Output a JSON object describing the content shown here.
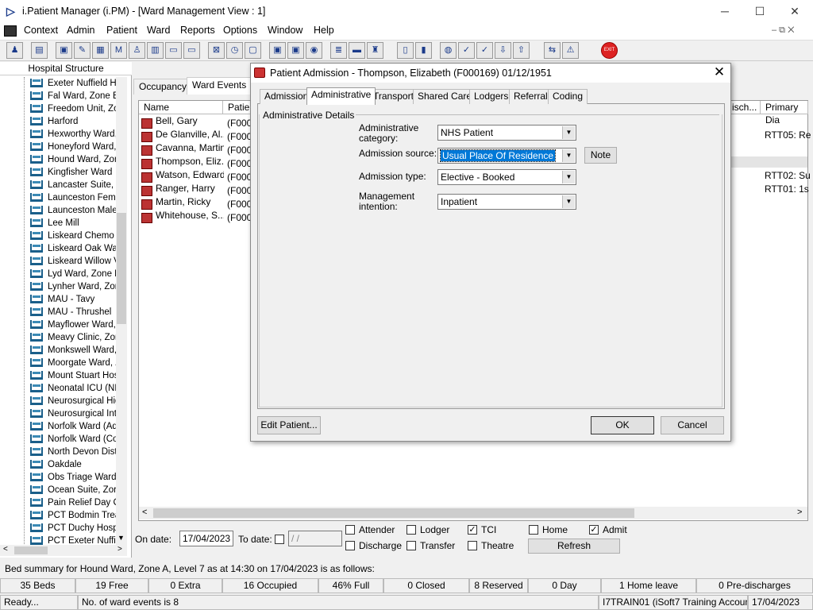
{
  "window": {
    "title": "i.Patient Manager (i.PM) - [Ward Management View : 1]",
    "minimize": "─",
    "maximize": "☐",
    "close": "✕"
  },
  "menu": [
    "Context",
    "Admin",
    "Patient",
    "Ward",
    "Reports",
    "Options",
    "Window",
    "Help"
  ],
  "mdi_controls": "–  ⧉  ✕",
  "toolbar_exit_label": "EXIT",
  "left_pane": {
    "header": "Hospital Structure",
    "items": [
      "Exeter Nuffield Ho",
      "Fal Ward, Zone B",
      "Freedom Unit, Zo",
      "Harford",
      "Hexworthy Ward,",
      "Honeyford Ward,",
      "Hound Ward, Zon",
      "Kingfisher Ward",
      "Lancaster Suite, Z",
      "Launceston Fema",
      "Launceston Male",
      "Lee Mill",
      "Liskeard Chemo D",
      "Liskeard Oak Wa",
      "Liskeard Willow V",
      "Lyd Ward, Zone B",
      "Lynher Ward, Zor",
      "MAU - Tavy",
      "MAU - Thrushel",
      "Mayflower Ward,",
      "Meavy Clinic, Zor",
      "Monkswell Ward,",
      "Moorgate Ward, Z",
      "Mount Stuart Hos",
      "Neonatal ICU (NN",
      "Neurosurgical Hig",
      "Neurosurgical Inte",
      "Norfolk Ward (Ad",
      "Norfolk Ward (Co",
      "North Devon Dist",
      "Oakdale",
      "Obs Triage Ward",
      "Ocean Suite, Zor",
      "Pain Relief Day C",
      "PCT Bodmin Trea",
      "PCT Duchy Hosp",
      "PCT Exeter Nuffie"
    ]
  },
  "ward": {
    "tabs": [
      "Occupancy",
      "Ward Events"
    ],
    "columns": [
      "Name",
      "Patien",
      "isch...",
      "Primary Dia"
    ],
    "rows": [
      {
        "name": "Bell, Gary",
        "id": "(F000"
      },
      {
        "name": "De Glanville, Al...",
        "id": "(F000"
      },
      {
        "name": "Cavanna, Martin",
        "id": "(F000"
      },
      {
        "name": "Thompson, Eliz...",
        "id": "(F000"
      },
      {
        "name": "Watson, Edward",
        "id": "(F000"
      },
      {
        "name": "Ranger, Harry",
        "id": "(F000"
      },
      {
        "name": "Martin, Ricky",
        "id": "(F000"
      },
      {
        "name": "Whitehouse, S...",
        "id": "(F000"
      }
    ],
    "right_cells": [
      "RTT05: Re",
      "RTT02: Su",
      "RTT01: 1s"
    ],
    "on_date_label": "On date:",
    "on_date": "17/04/2023",
    "to_date_label": "To date:",
    "to_date": " / /",
    "checks": {
      "attender": "Attender",
      "discharge": "Discharge",
      "lodger": "Lodger",
      "transfer": "Transfer",
      "tci": "TCI",
      "theatre": "Theatre",
      "home": "Home",
      "admit": "Admit"
    },
    "refresh": "Refresh"
  },
  "status": {
    "summary": "Bed summary for Hound Ward, Zone A, Level 7 as at 14:30 on 17/04/2023 is as follows:",
    "beds": [
      "35 Beds",
      "19 Free",
      "0 Extra",
      "16 Occupied",
      "46% Full",
      "0 Closed",
      "8 Reserved",
      "0 Day",
      "1 Home leave",
      "0 Pre-discharges"
    ],
    "ready": "Ready...",
    "events": "No. of ward events is 8",
    "user": "I7TRAIN01 (iSoft7 Training Account)",
    "date": "17/04/2023"
  },
  "dialog": {
    "title": "Patient Admission - Thompson, Elizabeth (F000169) 01/12/1951",
    "close": "✕",
    "tabs": [
      "Admission",
      "Administrative",
      "Transport",
      "Shared Care",
      "Lodgers",
      "Referral",
      "Coding"
    ],
    "active_tab": "Administrative",
    "group": "Administrative Details",
    "fields": {
      "category_label_1": "Administrative",
      "category_label_2": "category:",
      "category": "NHS Patient",
      "source_label": "Admission source:",
      "source": "Usual Place Of Residence",
      "type_label": "Admission type:",
      "type": "Elective - Booked",
      "intent_label_1": "Management",
      "intent_label_2": "intention:",
      "intent": "Inpatient"
    },
    "note": "Note",
    "edit_patient": "Edit Patient...",
    "ok": "OK",
    "cancel": "Cancel"
  }
}
